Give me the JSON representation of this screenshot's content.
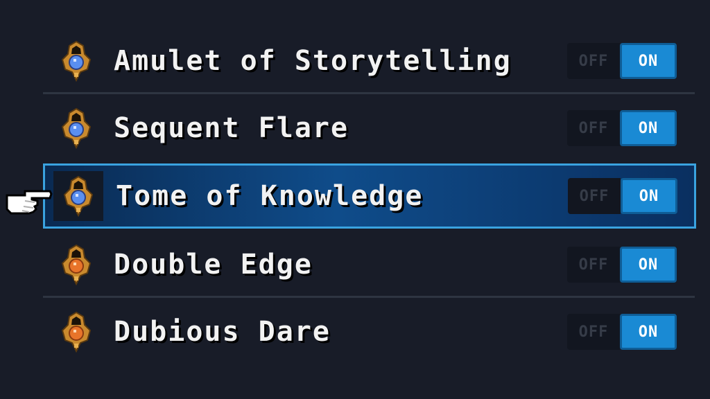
{
  "options": [
    {
      "label": "Amulet of Storytelling",
      "off_label": "OFF",
      "on_label": "ON",
      "state": "ON",
      "gem_color": "#5a8ff0",
      "selected": false
    },
    {
      "label": "Sequent Flare",
      "off_label": "OFF",
      "on_label": "ON",
      "state": "ON",
      "gem_color": "#5a8ff0",
      "selected": false
    },
    {
      "label": "Tome of Knowledge",
      "off_label": "OFF",
      "on_label": "ON",
      "state": "ON",
      "gem_color": "#5a8ff0",
      "selected": true
    },
    {
      "label": "Double Edge",
      "off_label": "OFF",
      "on_label": "ON",
      "state": "ON",
      "gem_color": "#e8742a",
      "selected": false
    },
    {
      "label": "Dubious Dare",
      "off_label": "OFF",
      "on_label": "ON",
      "state": "ON",
      "gem_color": "#e8742a",
      "selected": false
    }
  ],
  "icons": {
    "option": "amulet-icon",
    "cursor": "pointing-hand-icon"
  },
  "colors": {
    "background": "#181c28",
    "selection_border": "#3aa3e0",
    "toggle_on": "#1a8ad4",
    "toggle_off": "#121620"
  }
}
